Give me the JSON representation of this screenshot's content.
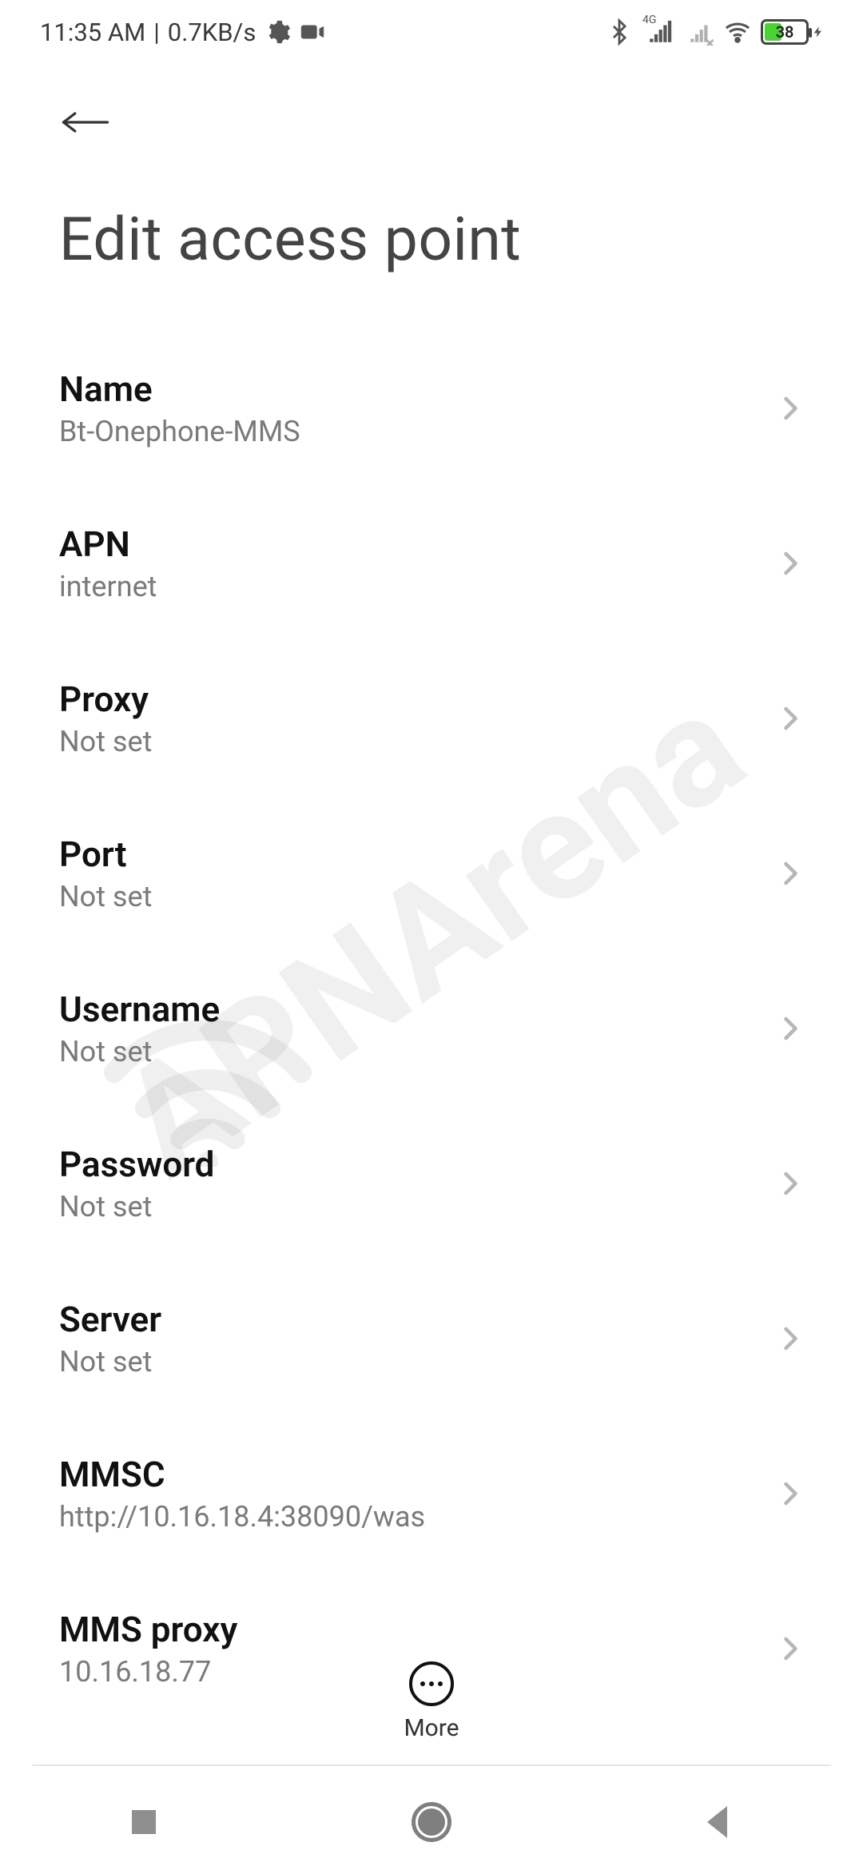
{
  "status": {
    "time": "11:35 AM",
    "speed": "0.7KB/s",
    "network": "4G",
    "battery_pct": "38"
  },
  "header": {
    "title": "Edit access point"
  },
  "rows": [
    {
      "title": "Name",
      "sub": "Bt-Onephone-MMS"
    },
    {
      "title": "APN",
      "sub": "internet"
    },
    {
      "title": "Proxy",
      "sub": "Not set"
    },
    {
      "title": "Port",
      "sub": "Not set"
    },
    {
      "title": "Username",
      "sub": "Not set"
    },
    {
      "title": "Password",
      "sub": "Not set"
    },
    {
      "title": "Server",
      "sub": "Not set"
    },
    {
      "title": "MMSC",
      "sub": "http://10.16.18.4:38090/was"
    },
    {
      "title": "MMS proxy",
      "sub": "10.16.18.77"
    }
  ],
  "bottom": {
    "more": "More"
  },
  "watermark": "APNArena"
}
